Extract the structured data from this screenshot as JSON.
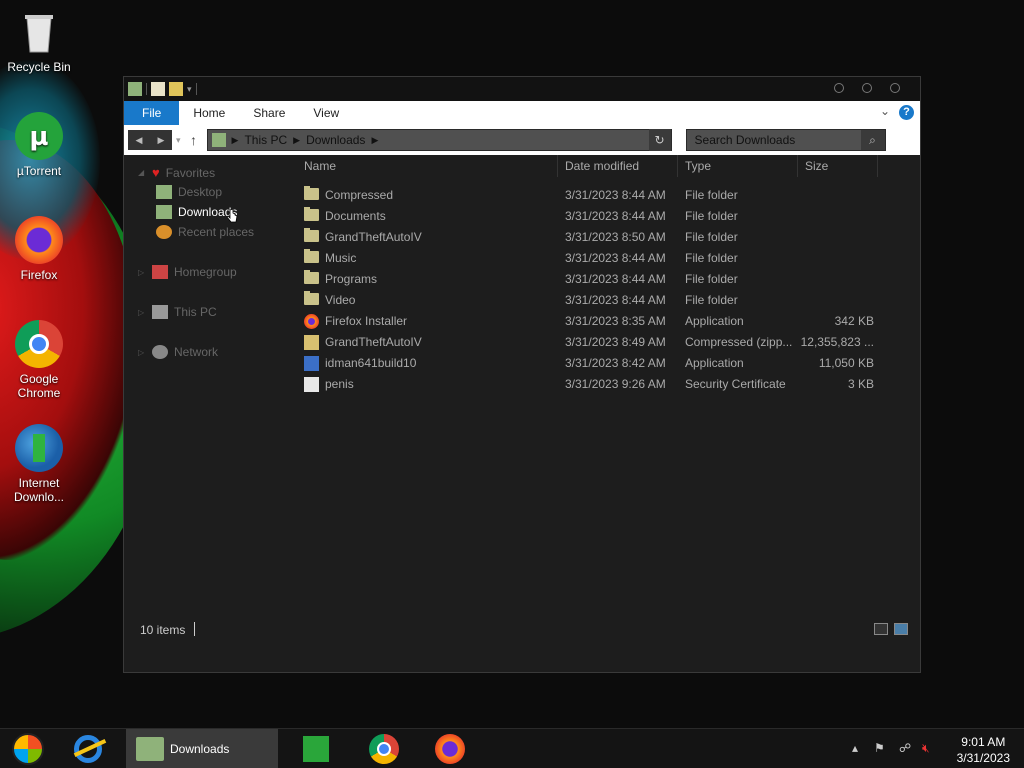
{
  "desktop": {
    "icons": [
      {
        "label": "Recycle Bin",
        "icon": "recycle-bin-icon"
      },
      {
        "label": "µTorrent",
        "icon": "utorrent-icon"
      },
      {
        "label": "Firefox",
        "icon": "firefox-icon"
      },
      {
        "label": "Google Chrome",
        "icon": "chrome-icon"
      },
      {
        "label": "Internet Downlo...",
        "icon": "idm-icon"
      }
    ]
  },
  "window": {
    "ribbon": {
      "tabs": [
        "File",
        "Home",
        "Share",
        "View"
      ]
    },
    "address": {
      "crumbs": [
        "This PC",
        "Downloads"
      ]
    },
    "search": {
      "placeholder": "Search Downloads"
    },
    "navpane": {
      "favorites": "Favorites",
      "desktop": "Desktop",
      "downloads": "Downloads",
      "recent": "Recent places",
      "homegroup": "Homegroup",
      "thispc": "This PC",
      "network": "Network"
    },
    "columns": [
      "Name",
      "Date modified",
      "Type",
      "Size"
    ],
    "files": [
      {
        "name": "Compressed",
        "date": "3/31/2023 8:44 AM",
        "type": "File folder",
        "size": "",
        "kind": "folder"
      },
      {
        "name": "Documents",
        "date": "3/31/2023 8:44 AM",
        "type": "File folder",
        "size": "",
        "kind": "folder"
      },
      {
        "name": "GrandTheftAutoIV",
        "date": "3/31/2023 8:50 AM",
        "type": "File folder",
        "size": "",
        "kind": "folder"
      },
      {
        "name": "Music",
        "date": "3/31/2023 8:44 AM",
        "type": "File folder",
        "size": "",
        "kind": "folder"
      },
      {
        "name": "Programs",
        "date": "3/31/2023 8:44 AM",
        "type": "File folder",
        "size": "",
        "kind": "folder"
      },
      {
        "name": "Video",
        "date": "3/31/2023 8:44 AM",
        "type": "File folder",
        "size": "",
        "kind": "folder"
      },
      {
        "name": "Firefox Installer",
        "date": "3/31/2023 8:35 AM",
        "type": "Application",
        "size": "342 KB",
        "kind": "firefox"
      },
      {
        "name": "GrandTheftAutoIV",
        "date": "3/31/2023 8:49 AM",
        "type": "Compressed (zipp...",
        "size": "12,355,823 ...",
        "kind": "zip"
      },
      {
        "name": "idman641build10",
        "date": "3/31/2023 8:42 AM",
        "type": "Application",
        "size": "11,050 KB",
        "kind": "app"
      },
      {
        "name": "penis",
        "date": "3/31/2023 9:26 AM",
        "type": "Security Certificate",
        "size": "3 KB",
        "kind": "cert"
      }
    ],
    "status": {
      "count": "10 items"
    }
  },
  "taskbar": {
    "active_label": "Downloads",
    "time": "9:01 AM",
    "date": "3/31/2023"
  },
  "colors": {
    "accent": "#1979ca",
    "folder": "#c9c28a"
  }
}
